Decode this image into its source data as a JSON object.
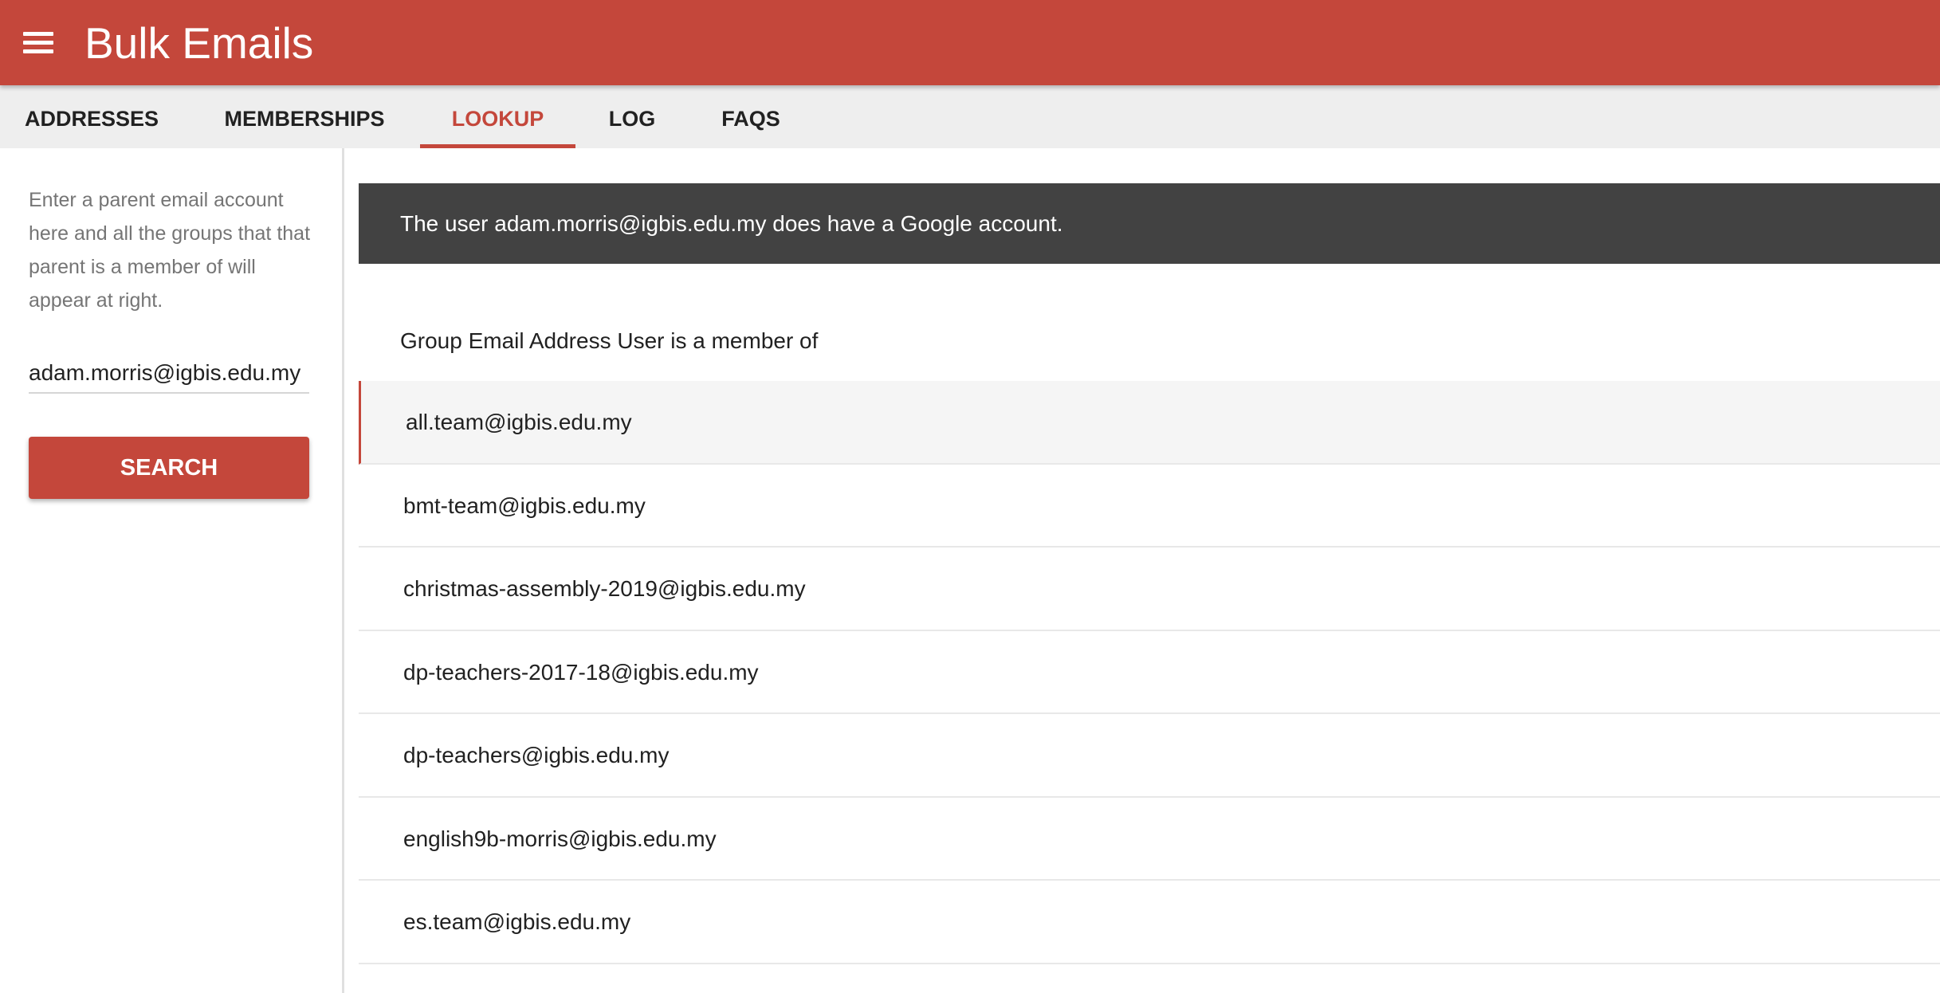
{
  "app": {
    "title": "Bulk Emails",
    "menu_icon": "hamburger-menu-icon",
    "accent_color": "#c4473b"
  },
  "tabs": [
    {
      "label": "ADDRESSES",
      "active": false
    },
    {
      "label": "MEMBERSHIPS",
      "active": false
    },
    {
      "label": "LOOKUP",
      "active": true
    },
    {
      "label": "LOG",
      "active": false
    },
    {
      "label": "FAQS",
      "active": false
    }
  ],
  "sidebar": {
    "help_text": "Enter a parent email account here and all the groups that that parent is a member of will appear at right.",
    "email_value": "adam.morris@igbis.edu.my",
    "search_label": "SEARCH"
  },
  "main": {
    "status_message": "The user adam.morris@igbis.edu.my does have a Google account.",
    "list_header": "Group Email Address User is a member of",
    "groups": [
      "all.team@igbis.edu.my",
      "bmt-team@igbis.edu.my",
      "christmas-assembly-2019@igbis.edu.my",
      "dp-teachers-2017-18@igbis.edu.my",
      "dp-teachers@igbis.edu.my",
      "english9b-morris@igbis.edu.my",
      "es.team@igbis.edu.my"
    ]
  }
}
